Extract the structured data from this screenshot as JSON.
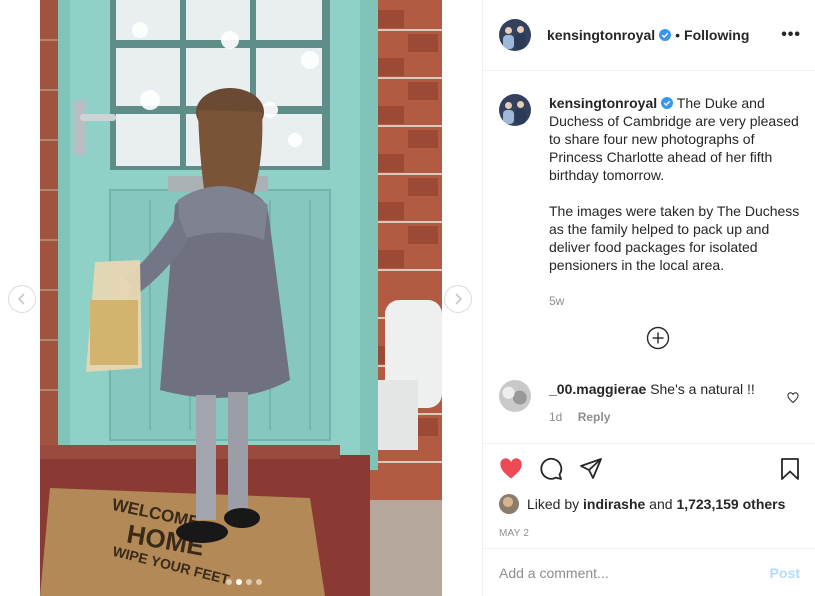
{
  "header": {
    "username": "kensingtonroyal",
    "separator": "•",
    "follow_state": "Following",
    "more": "•••"
  },
  "caption": {
    "username": "kensingtonroyal",
    "text": "The Duke and Duchess of Cambridge are very pleased to share four new photographs of Princess Charlotte ahead of her fifth birthday tomorrow.\n\nThe images were taken by The Duchess as the family helped to pack up and deliver food packages for isolated pensioners in the local area.",
    "time": "5w"
  },
  "comment": {
    "username": "_00.maggierae",
    "text": "She's a natural !!",
    "time": "1d",
    "reply_label": "Reply"
  },
  "likes": {
    "prefix": "Liked by ",
    "user": "indirashe",
    "middle": " and ",
    "count": "1,723,159 others"
  },
  "date": "MAY 2",
  "add_comment": {
    "placeholder": "Add a comment...",
    "post_label": "Post"
  },
  "carousel": {
    "total": 4,
    "active_index": 1
  },
  "icons": [
    "chevron-left-icon",
    "chevron-right-icon",
    "verified-badge-icon",
    "more-options-icon",
    "plus-circle-icon",
    "heart-icon",
    "comment-icon",
    "share-icon",
    "bookmark-icon"
  ],
  "colors": {
    "verified": "#3897f0",
    "liked_heart": "#ed4956",
    "post_disabled": "#b3dbff",
    "door": "#8fd0c7"
  }
}
